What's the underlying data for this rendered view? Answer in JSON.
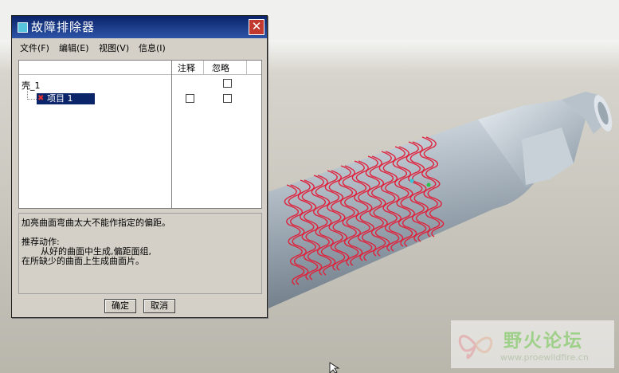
{
  "dialog": {
    "title": "故障排除器",
    "close_glyph": "✕",
    "menu": [
      {
        "label": "文件(F)"
      },
      {
        "label": "编辑(E)"
      },
      {
        "label": "视图(V)"
      },
      {
        "label": "信息(I)"
      }
    ],
    "columns": {
      "annotation": "注释",
      "ignore": "忽略"
    },
    "tree": {
      "root_label": "壳_1",
      "item_label": "项目 1",
      "item_icon": "error-x-icon",
      "item_status_color": "#e03030"
    },
    "message": {
      "line1": "加亮曲面弯曲太大不能作指定的偏距。",
      "line2": "推荐动作:",
      "line3": "从好的曲面中生成,偏距面组,",
      "line4": "在所缺少的曲面上生成曲面片。"
    },
    "buttons": {
      "ok": "确定",
      "cancel": "取消"
    }
  },
  "watermark": {
    "title": "野火论坛",
    "url": "www.proewildfire.cn"
  },
  "colors": {
    "title_bar": "#0a246a",
    "close_button": "#c23a2f",
    "model_curves": "#e0203a",
    "model_body": "#a8b3bd"
  }
}
